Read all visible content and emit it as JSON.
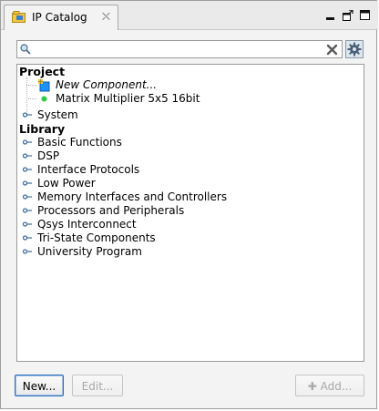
{
  "tab": {
    "title": "IP Catalog"
  },
  "search": {
    "value": "",
    "placeholder": ""
  },
  "tree": {
    "project": {
      "label": "Project",
      "items": [
        {
          "label": "New Component...",
          "icon": "new-component-icon",
          "style": "italic"
        },
        {
          "label": "Matrix Multiplier 5x5 16bit",
          "icon": "green-dot-icon"
        }
      ],
      "system": "System"
    },
    "library": {
      "label": "Library",
      "items": [
        "Basic Functions",
        "DSP",
        "Interface Protocols",
        "Low Power",
        "Memory Interfaces and Controllers",
        "Processors and Peripherals",
        "Qsys Interconnect",
        "Tri-State Components",
        "University Program"
      ]
    }
  },
  "buttons": {
    "new": "New...",
    "edit": "Edit...",
    "add": "Add..."
  },
  "colors": {
    "accent": "#2f6fba",
    "component_icon": "#1e90ff",
    "status_dot": "#2ecc40"
  }
}
